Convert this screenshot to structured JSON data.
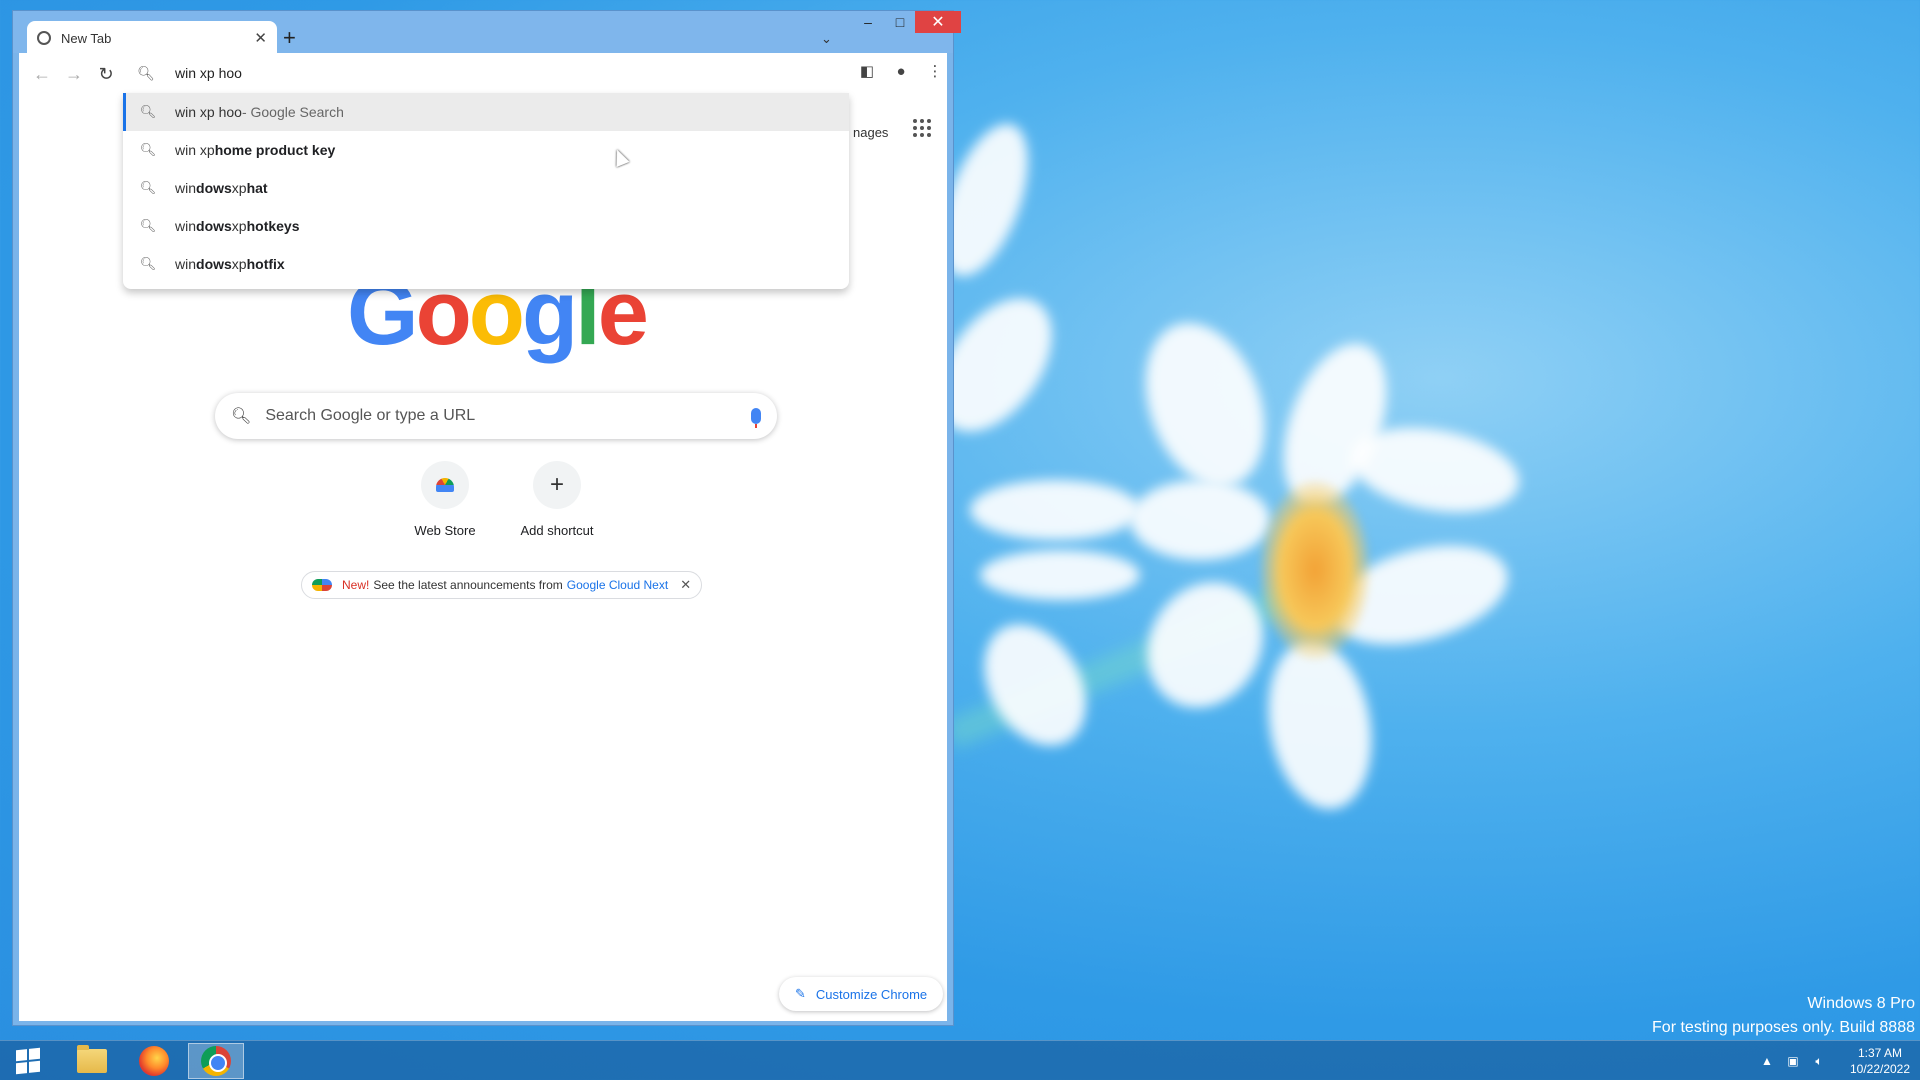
{
  "browser": {
    "tab_title": "New Tab",
    "new_tab": "+",
    "tab_list": "⌄",
    "window_controls": {
      "minimize": "–",
      "maximize": "□",
      "close": "✕"
    }
  },
  "omnibox": {
    "value": "win xp hoo",
    "search_icon": "search-icon"
  },
  "suggestions": [
    {
      "prefix": "win xp hoo",
      "bold": "",
      "suffix": " - Google Search",
      "selected": true
    },
    {
      "prefix": "win xp ",
      "bold": "home product key",
      "suffix": "",
      "selected": false
    },
    {
      "prefix": "win",
      "bold": "dows",
      "mid": " xp ",
      "bold2": "hat"
    },
    {
      "prefix": "win",
      "bold": "dows",
      "mid": " xp ",
      "bold2": "hotkeys"
    },
    {
      "prefix": "win",
      "bold": "dows",
      "mid": " xp ",
      "bold2": "hotfix"
    }
  ],
  "page": {
    "images_link": "nages",
    "logo": [
      "G",
      "o",
      "o",
      "g",
      "l",
      "e"
    ],
    "logo_colors": [
      "#4285f4",
      "#ea4335",
      "#fbbc05",
      "#4285f4",
      "#34a853",
      "#ea4335"
    ],
    "search_placeholder": "Search Google or type a URL",
    "shortcuts": [
      {
        "label": "Web Store",
        "icon": "webstore-icon"
      },
      {
        "label": "Add shortcut",
        "icon": "plus-icon"
      }
    ],
    "promo": {
      "new": "New!",
      "text": "See the latest announcements from",
      "link": "Google Cloud Next"
    },
    "customize": "Customize Chrome"
  },
  "desktop": {
    "watermark_line1": "Windows 8 Pro",
    "watermark_line2": "For testing purposes only. Build 8888"
  },
  "taskbar": {
    "time": "1:37 AM",
    "date": "10/22/2022"
  },
  "colors": {
    "accent": "#1a73e8",
    "close_red": "#e04343",
    "desktop_blue": "#3aa3ea"
  }
}
